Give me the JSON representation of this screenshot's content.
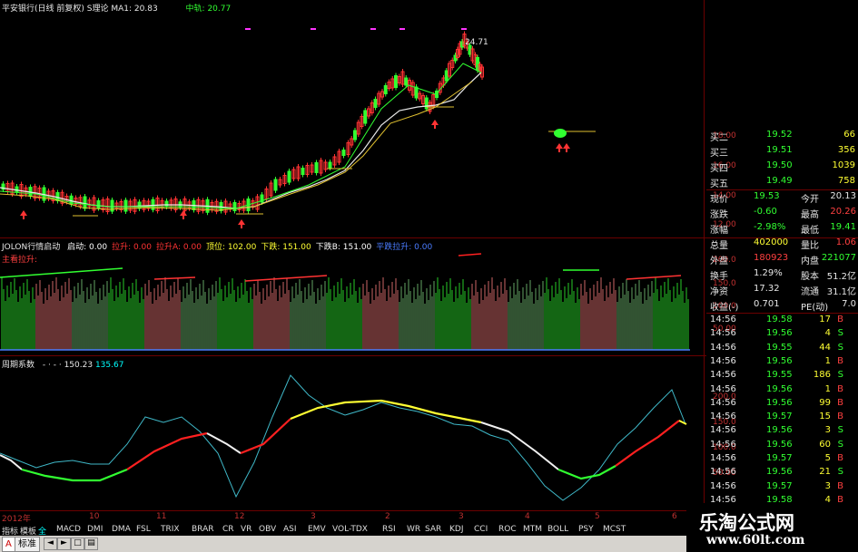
{
  "title_bar": {
    "stock": "平安银行(日线 前复权)",
    "indicator": "S理论",
    "ma_label": "MA1: 20.83",
    "mid_label": "中轨: 20.77"
  },
  "price_chart": {
    "high_label": "24.71",
    "axis": [
      "18.00",
      "16.00",
      "14.00",
      "12.00"
    ],
    "buy_marker": "买"
  },
  "indicator2": {
    "name": "JOLON行情启动",
    "fields": [
      {
        "label": "启动:",
        "value": "0.00",
        "color": "#ffffff"
      },
      {
        "label": "拉升:",
        "value": "0.00",
        "color": "#ff3333"
      },
      {
        "label": "拉升A:",
        "value": "0.00",
        "color": "#ff3333"
      },
      {
        "label": "顶位:",
        "value": "102.00",
        "color": "#ffff33"
      },
      {
        "label": "下跌:",
        "value": "151.00",
        "color": "#ffff33"
      },
      {
        "label": "下跌B:",
        "value": "151.00",
        "color": "#ffffff"
      },
      {
        "label": "平跌拉升:",
        "value": "0.00",
        "color": "#4a7cff"
      }
    ],
    "sub_label": "主看拉升:",
    "axis": [
      "200.0",
      "150.0",
      "100.0",
      "50.00"
    ]
  },
  "indicator3": {
    "name": "周期系数",
    "dashes": "- · - ·",
    "v1": "150.23",
    "v2": "135.67",
    "axis": [
      "200.0",
      "150.0",
      "100.0",
      "50.00"
    ]
  },
  "x_axis": {
    "labels": [
      "2012年",
      "10",
      "11",
      "12",
      "3",
      "2",
      "3",
      "4",
      "5",
      "6"
    ]
  },
  "order_book": [
    {
      "label": "买二",
      "price": "19.52",
      "vol": "66"
    },
    {
      "label": "买三",
      "price": "19.51",
      "vol": "356"
    },
    {
      "label": "买四",
      "price": "19.50",
      "vol": "1039"
    },
    {
      "label": "买五",
      "price": "19.49",
      "vol": "758"
    }
  ],
  "quote": [
    {
      "l1": "现价",
      "v1": "19.53",
      "v1c": "green",
      "l2": "今开",
      "v2": "20.13",
      "v2c": "white"
    },
    {
      "l1": "涨跌",
      "v1": "-0.60",
      "v1c": "green",
      "l2": "最高",
      "v2": "20.26",
      "v2c": "red"
    },
    {
      "l1": "涨幅",
      "v1": "-2.98%",
      "v1c": "green",
      "l2": "最低",
      "v2": "19.41",
      "v2c": "green"
    },
    {
      "l1": "总量",
      "v1": "402000",
      "v1c": "yellow",
      "l2": "量比",
      "v2": "1.06",
      "v2c": "red"
    },
    {
      "l1": "外盘",
      "v1": "180923",
      "v1c": "red",
      "l2": "内盘",
      "v2": "221077",
      "v2c": "green"
    },
    {
      "l1": "换手",
      "v1": "1.29%",
      "v1c": "white",
      "l2": "股本",
      "v2": "51.2亿",
      "v2c": "white"
    },
    {
      "l1": "净资",
      "v1": "17.32",
      "v1c": "white",
      "l2": "流通",
      "v2": "31.1亿",
      "v2c": "white"
    },
    {
      "l1": "收益(-)",
      "v1": "0.701",
      "v1c": "white",
      "l2": "PE(动)",
      "v2": "7.0",
      "v2c": "white"
    }
  ],
  "ticks": [
    {
      "t": "14:56",
      "p": "19.58",
      "v": "17",
      "s": "B"
    },
    {
      "t": "14:56",
      "p": "19.56",
      "v": "4",
      "s": "S"
    },
    {
      "t": "14:56",
      "p": "19.55",
      "v": "44",
      "s": "S"
    },
    {
      "t": "14:56",
      "p": "19.56",
      "v": "1",
      "s": "B"
    },
    {
      "t": "14:56",
      "p": "19.55",
      "v": "186",
      "s": "S"
    },
    {
      "t": "14:56",
      "p": "19.56",
      "v": "1",
      "s": "B"
    },
    {
      "t": "14:56",
      "p": "19.56",
      "v": "99",
      "s": "B"
    },
    {
      "t": "14:56",
      "p": "19.57",
      "v": "15",
      "s": "B"
    },
    {
      "t": "14:56",
      "p": "19.56",
      "v": "3",
      "s": "S"
    },
    {
      "t": "14:56",
      "p": "19.56",
      "v": "60",
      "s": "S"
    },
    {
      "t": "14:56",
      "p": "19.57",
      "v": "5",
      "s": "B"
    },
    {
      "t": "14:56",
      "p": "19.56",
      "v": "21",
      "s": "S"
    },
    {
      "t": "14:56",
      "p": "19.57",
      "v": "3",
      "s": "B"
    },
    {
      "t": "14:56",
      "p": "19.58",
      "v": "4",
      "s": "B"
    }
  ],
  "index_tabs": [
    "指标",
    "模板",
    "全",
    "MACD",
    "DMI",
    "DMA",
    "FSL",
    "TRIX",
    "BRAR",
    "CR",
    "VR",
    "OBV",
    "ASI",
    "EMV",
    "VOL-TDX",
    "RSI",
    "WR",
    "SAR",
    "KDJ",
    "CCI",
    "ROC",
    "MTM",
    "BOLL",
    "PSY",
    "MCST"
  ],
  "bottom_bar": {
    "label": "标准"
  },
  "watermark": {
    "cn": "乐淘公式网",
    "url": "www.60lt.com"
  }
}
